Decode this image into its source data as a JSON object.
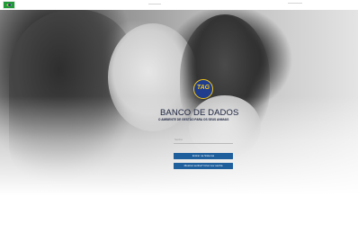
{
  "header": {
    "flag_icon": "brazil-flag-icon"
  },
  "hero": {
    "logo_text": "TAG",
    "title": "BANCO DE DADOS",
    "subtitle": "O AMBIENTE DE GESTÃO PARA OS SEUS ANIMAIS"
  },
  "login": {
    "field_placeholder": "Senha",
    "enter_label": "Entrar na Sistema",
    "forgot_label": "Mostrar senha? Criar nov senha"
  },
  "colors": {
    "brand_blue": "#1f5f9c",
    "logo_blue": "#1f3d8c",
    "logo_gold": "#f2c51c",
    "title_navy": "#1c2340"
  }
}
